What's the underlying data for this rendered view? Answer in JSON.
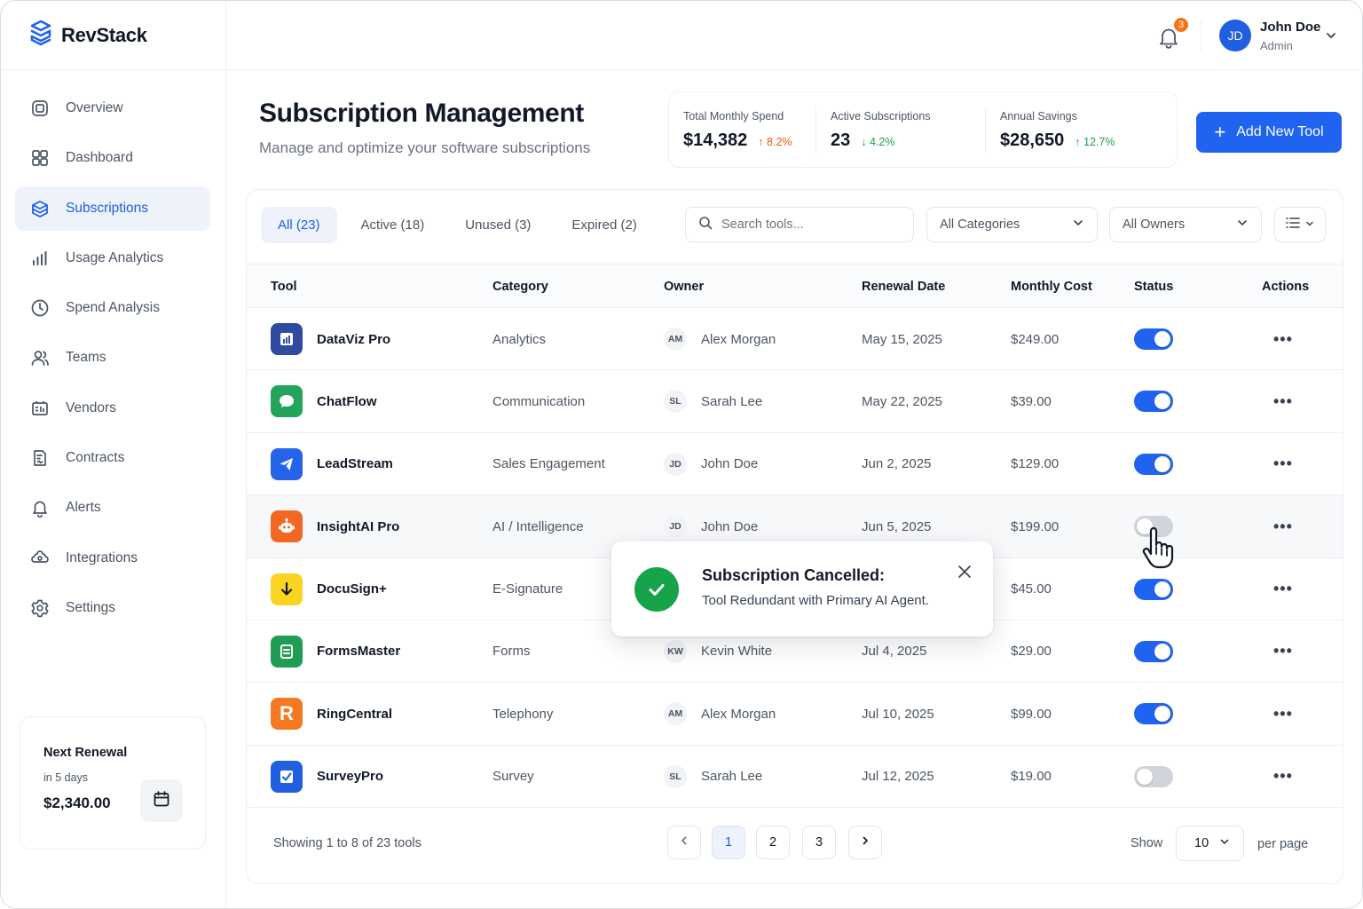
{
  "brand": {
    "name": "RevStack"
  },
  "colors": {
    "accent": "#1f63f0",
    "active_bg": "#eef2fb",
    "success": "#16a34a",
    "badge": "#f97316"
  },
  "sidebar": {
    "items": [
      {
        "label": "Overview",
        "icon": "overview-icon",
        "active": false
      },
      {
        "label": "Dashboard",
        "icon": "dashboard-grid-icon",
        "active": false
      },
      {
        "label": "Subscriptions",
        "icon": "box-icon",
        "active": true
      },
      {
        "label": "Usage Analytics",
        "icon": "bar-chart-icon",
        "active": false
      },
      {
        "label": "Spend Analysis",
        "icon": "clock-icon",
        "active": false
      },
      {
        "label": "Teams",
        "icon": "users-icon",
        "active": false
      },
      {
        "label": "Vendors",
        "icon": "vendors-icon",
        "active": false
      },
      {
        "label": "Contracts",
        "icon": "contract-icon",
        "active": false
      },
      {
        "label": "Alerts",
        "icon": "bell-icon",
        "active": false
      },
      {
        "label": "Integrations",
        "icon": "integrations-icon",
        "active": false
      },
      {
        "label": "Settings",
        "icon": "gear-icon",
        "active": false
      }
    ],
    "renewal": {
      "title": "Next Renewal",
      "sub": "in 5 days",
      "amount": "$2,340.00"
    }
  },
  "topbar": {
    "notifications": "3",
    "user": {
      "initials": "JD",
      "name": "John Doe",
      "role": "Admin"
    }
  },
  "header": {
    "title": "Subscription Management",
    "subtitle": "Manage and optimize your software subscriptions",
    "add_button": "Add New Tool"
  },
  "stats": [
    {
      "label": "Total Monthly Spend",
      "value": "$14,382",
      "change": "8.2%",
      "direction": "up",
      "tone": "orange"
    },
    {
      "label": "Active Subscriptions",
      "value": "23",
      "change": "4.2%",
      "direction": "down",
      "tone": "green"
    },
    {
      "label": "Annual Savings",
      "value": "$28,650",
      "change": "12.7%",
      "direction": "up",
      "tone": "green"
    }
  ],
  "filters": {
    "tabs": [
      "All (23)",
      "Active (18)",
      "Unused (3)",
      "Expired (2)"
    ],
    "search_placeholder": "Search tools...",
    "category": "All Categories",
    "owner": "All Owners"
  },
  "table": {
    "columns": [
      "Tool",
      "Category",
      "Owner",
      "Renewal Date",
      "Monthly Cost",
      "Status",
      "Actions"
    ],
    "rows": [
      {
        "tool": "DataViz Pro",
        "category": "Analytics",
        "owner_initials": "AM",
        "owner": "Alex Morgan",
        "renewal": "May 15, 2025",
        "cost": "$249.00",
        "active": true,
        "icon": "bar-chart-logo-icon",
        "color": "#2f4a9e"
      },
      {
        "tool": "ChatFlow",
        "category": "Communication",
        "owner_initials": "SL",
        "owner": "Sarah Lee",
        "renewal": "May 22, 2025",
        "cost": "$39.00",
        "active": true,
        "icon": "chat-bubble-logo-icon",
        "color": "#22a55a"
      },
      {
        "tool": "LeadStream",
        "category": "Sales Engagement",
        "owner_initials": "JD",
        "owner": "John Doe",
        "renewal": "Jun 2, 2025",
        "cost": "$129.00",
        "active": true,
        "icon": "paper-plane-logo-icon",
        "color": "#2563eb"
      },
      {
        "tool": "InsightAI Pro",
        "category": "AI / Intelligence",
        "owner_initials": "JD",
        "owner": "John Doe",
        "renewal": "Jun 5, 2025",
        "cost": "$199.00",
        "active": false,
        "icon": "robot-logo-icon",
        "color": "#f26722"
      },
      {
        "tool": "DocuSign+",
        "category": "E-Signature",
        "owner_initials": "",
        "owner": "",
        "renewal": "",
        "cost": "$45.00",
        "active": true,
        "icon": "down-arrow-logo-icon",
        "color": "#f9d423"
      },
      {
        "tool": "FormsMaster",
        "category": "Forms",
        "owner_initials": "KW",
        "owner": "Kevin White",
        "renewal": "Jul 4, 2025",
        "cost": "$29.00",
        "active": true,
        "icon": "form-logo-icon",
        "color": "#1f9d55"
      },
      {
        "tool": "RingCentral",
        "category": "Telephony",
        "owner_initials": "AM",
        "owner": "Alex Morgan",
        "renewal": "Jul 10, 2025",
        "cost": "$99.00",
        "active": true,
        "icon": "r-letter-logo-icon",
        "color": "#f47920"
      },
      {
        "tool": "SurveyPro",
        "category": "Survey",
        "owner_initials": "SL",
        "owner": "Sarah Lee",
        "renewal": "Jul 12, 2025",
        "cost": "$19.00",
        "active": false,
        "icon": "checkbox-logo-icon",
        "color": "#1f5fe0"
      }
    ]
  },
  "pagination": {
    "summary": "Showing 1 to 8 of 23 tools",
    "pages": [
      "1",
      "2",
      "3"
    ],
    "current": "1",
    "show_label": "Show",
    "per_page": "10",
    "per_page_label": "per page"
  },
  "toast": {
    "title": "Subscription Cancelled:",
    "message": "Tool Redundant with Primary AI Agent."
  }
}
